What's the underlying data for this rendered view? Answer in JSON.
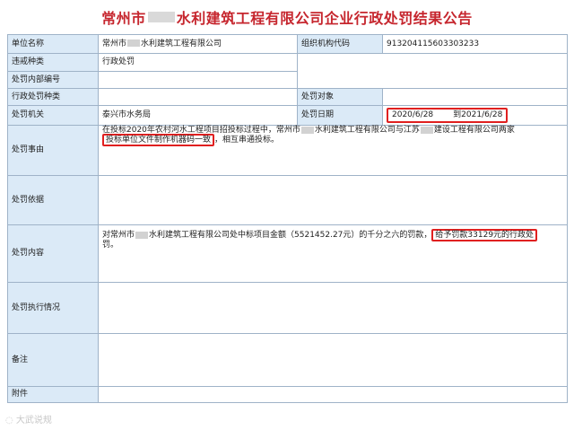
{
  "title": {
    "prefix": "常州市",
    "suffix": "水利建筑工程有限公司企业行政处罚结果公告"
  },
  "rows": {
    "unit_name_label": "单位名称",
    "unit_name_value_prefix": "常州市",
    "unit_name_value_suffix": "水利建筑工程有限公司",
    "org_code_label": "组织机构代码",
    "org_code_value": "913204115603303233",
    "violation_type_label": "违戒种类",
    "violation_type_value": "行政处罚",
    "internal_no_label": "处罚内部编号",
    "admin_type_label": "行政处罚种类",
    "target_label": "处罚对象",
    "authority_label": "处罚机关",
    "authority_value": "泰兴市水务局",
    "date_label": "处罚日期",
    "date_from": "2020/6/28",
    "date_to_word": "到",
    "date_to": "2021/6/28",
    "reason_label": "处罚事由",
    "reason_line1_a": "在投标2020年农村河水工程项目招投标过程中，常州市",
    "reason_line1_b": "水利建筑工程有限公司与江苏",
    "reason_line1_c": "建设工程有限公司两家",
    "reason_line2_boxed": "投标单位文件制作机器码一致",
    "reason_line2_rest": "，相互串通投标。",
    "basis_label": "处罚依据",
    "content_label": "处罚内容",
    "content_line1_a": "对常州市",
    "content_line1_b": "水利建筑工程有限公司处中标项目金额（5521452.27元）的千分之六的罚款，",
    "content_boxed": "给予罚款33129元的行政处",
    "content_line2": "罚。",
    "execution_label": "处罚执行情况",
    "remark_label": "备注",
    "attachment_label": "附件"
  },
  "watermark": "大武说规"
}
